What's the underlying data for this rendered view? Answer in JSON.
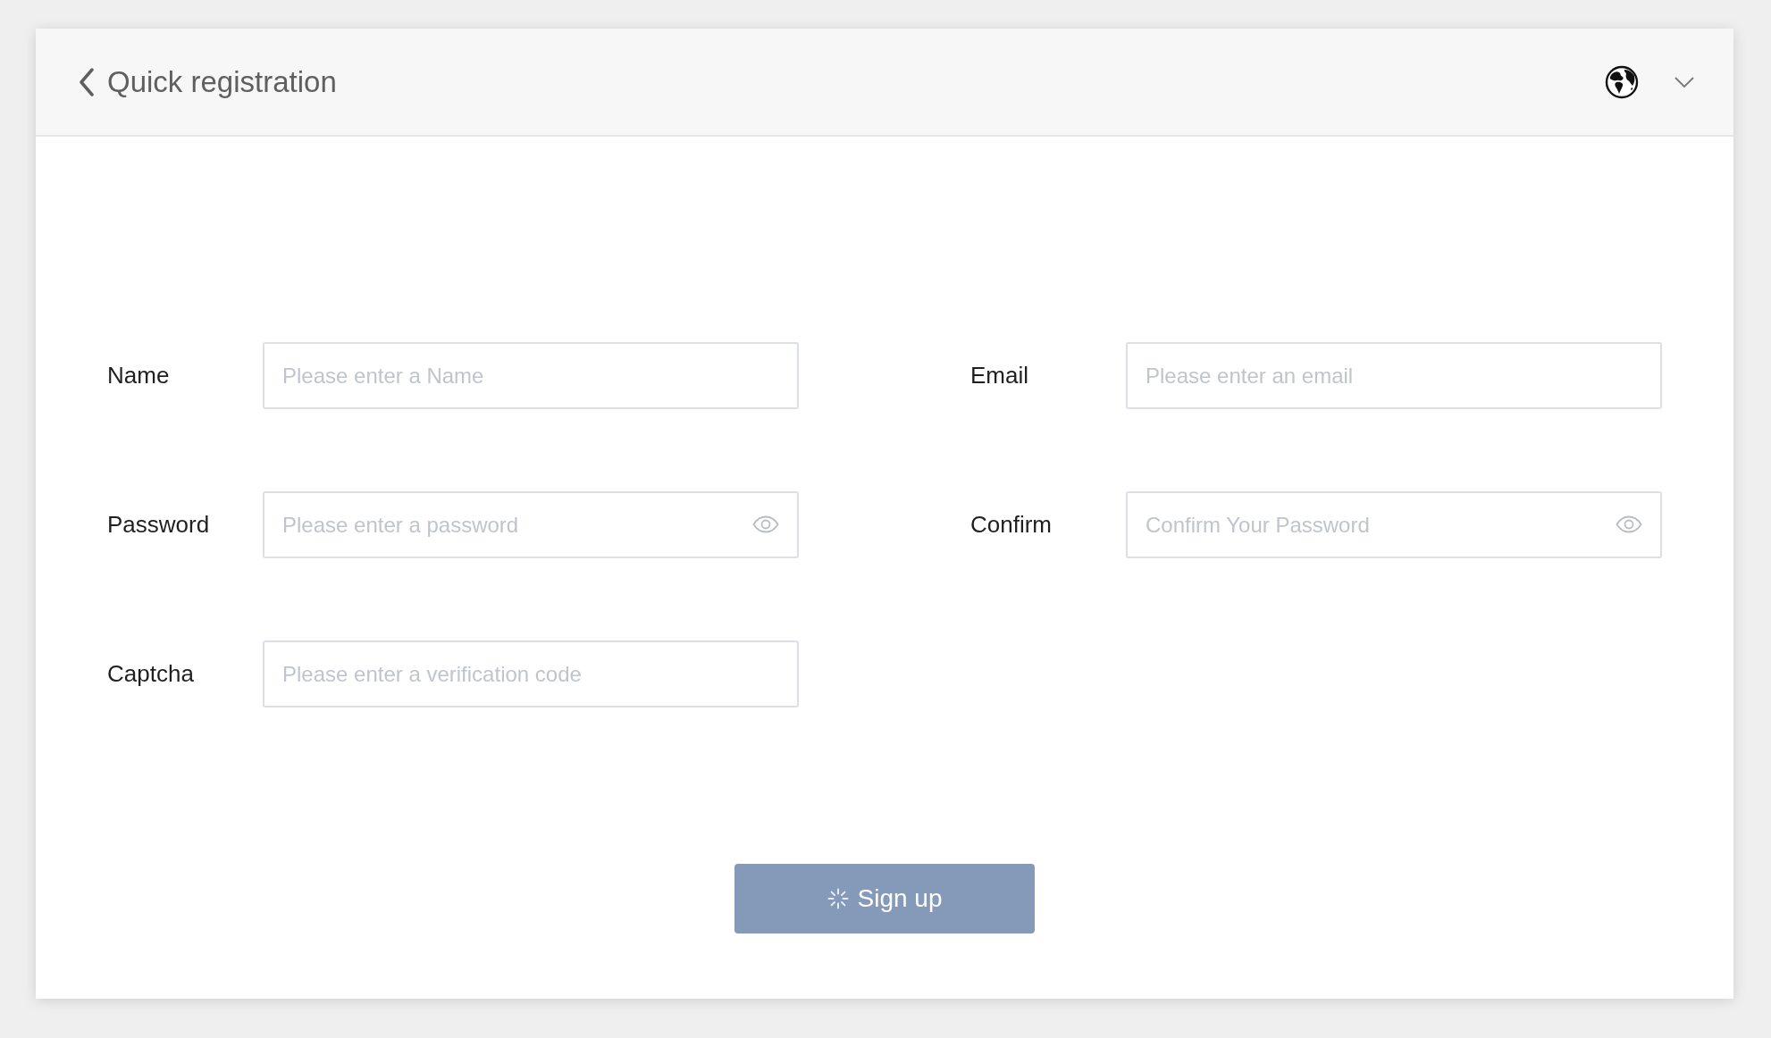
{
  "header": {
    "title": "Quick registration"
  },
  "form": {
    "fields": [
      {
        "label": "Name",
        "placeholder": "Please enter a Name",
        "kind": "text"
      },
      {
        "label": "Email",
        "placeholder": "Please enter an email",
        "kind": "text"
      },
      {
        "label": "Password",
        "placeholder": "Please enter a password",
        "kind": "password"
      },
      {
        "label": "Confirm",
        "placeholder": "Confirm Your Password",
        "kind": "password"
      },
      {
        "label": "Captcha",
        "placeholder": "Please enter a verification code",
        "kind": "text"
      }
    ]
  },
  "submit": {
    "label": "Sign up",
    "loading": true
  }
}
